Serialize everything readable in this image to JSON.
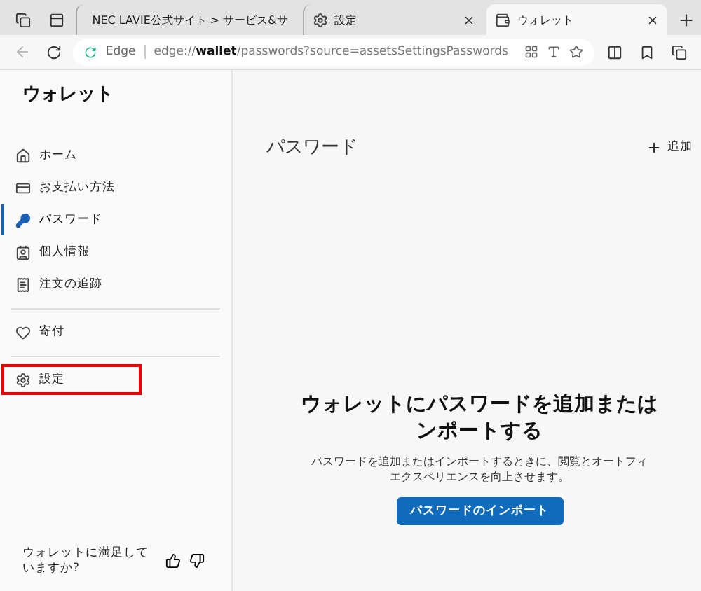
{
  "tabs": [
    {
      "kind": "workspaces"
    },
    {
      "kind": "tab-actions"
    },
    {
      "kind": "page",
      "label": "NEC LAVIE公式サイト > サービス&サ",
      "selected": false
    },
    {
      "kind": "page",
      "label": "設定",
      "selected": false
    },
    {
      "kind": "page",
      "label": "ウォレット",
      "selected": true
    },
    {
      "kind": "new"
    }
  ],
  "address_bar": {
    "back_disabled": true,
    "site_label": "Edge",
    "url": "edge://**wallet**/passwords?source=assetsSettingsPasswords"
  },
  "sidebar": {
    "title": "ウォレット",
    "items": [
      {
        "kind": "item",
        "label": "ホーム",
        "selected": false,
        "highlighted": false
      },
      {
        "kind": "item",
        "label": "お支払い方法",
        "selected": false,
        "highlighted": false
      },
      {
        "kind": "item",
        "label": "パスワード",
        "selected": true,
        "highlighted": false
      },
      {
        "kind": "item",
        "label": "個人情報",
        "selected": false,
        "highlighted": false
      },
      {
        "kind": "item",
        "label": "注文の追跡",
        "selected": false,
        "highlighted": false
      },
      {
        "kind": "divider"
      },
      {
        "kind": "item",
        "label": "寄付",
        "selected": false,
        "highlighted": false
      },
      {
        "kind": "divider"
      },
      {
        "kind": "item",
        "label": "設定",
        "selected": false,
        "highlighted": true
      }
    ],
    "feedback": "ウォレットに満足していますか?"
  },
  "main": {
    "title": "パスワード",
    "add_label": "追加",
    "empty_title_lines": [
      "ウォレットにパスワードを追加または",
      "ンポートする"
    ],
    "empty_text_lines": [
      "パスワードを追加またはインポートするときに、閲覧とオートフィ",
      "エクスペリエンスを向上させます。"
    ],
    "import_button": "パスワードのインポート"
  }
}
